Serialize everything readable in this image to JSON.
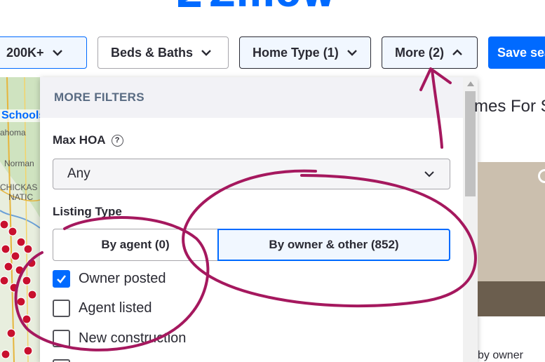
{
  "header": {
    "logo_text": "Zillow"
  },
  "filters": {
    "price_label": "200K+",
    "beds_baths_label": "Beds & Baths",
    "home_type_label": "Home Type (1)",
    "more_label": "More (2)",
    "save_search_label": "Save sea"
  },
  "map": {
    "schools_label": "Schools",
    "place_labels": [
      "ahoma",
      "Norman",
      "CHICKAS",
      "NATIC"
    ]
  },
  "more_filters": {
    "header": "MORE FILTERS",
    "max_hoa": {
      "label": "Max HOA",
      "help_glyph": "?",
      "value": "Any"
    },
    "listing_type": {
      "label": "Listing Type",
      "by_agent": "By agent (0)",
      "by_owner": "By owner & other (852)",
      "selected": "By owner & other (852)"
    },
    "checkboxes": [
      {
        "label": "Owner posted",
        "checked": true
      },
      {
        "label": "Agent listed",
        "checked": false
      },
      {
        "label": "New construction",
        "checked": false
      }
    ]
  },
  "listings": {
    "title": "mes For S",
    "card_caption": "by owner"
  },
  "colors": {
    "accent": "#006aff",
    "annotation": "#a5185e"
  }
}
